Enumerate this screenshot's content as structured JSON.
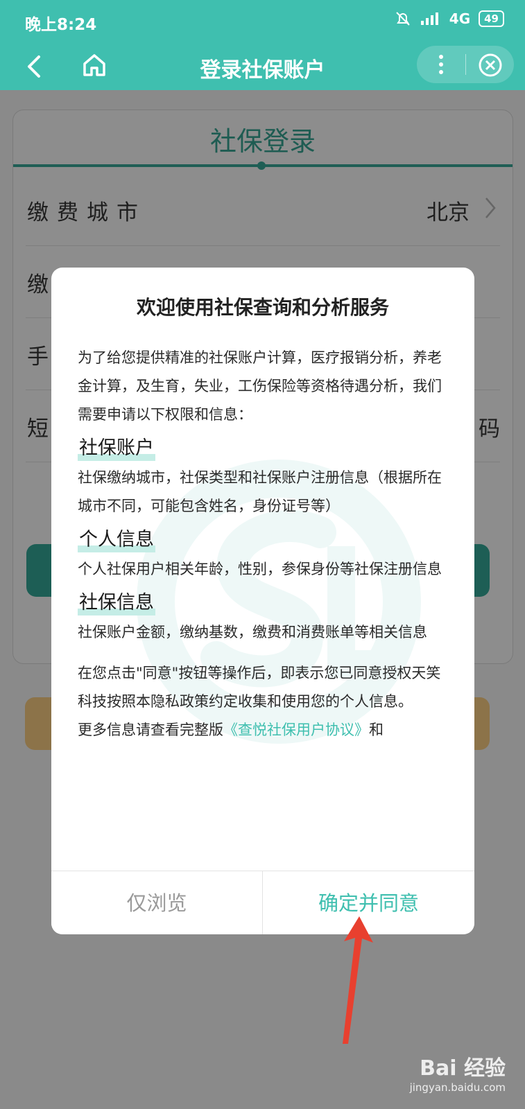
{
  "status_bar": {
    "time": "晚上8:24",
    "network": "4G",
    "battery": "49"
  },
  "header": {
    "title": "登录社保账户"
  },
  "login_card": {
    "title": "社保登录",
    "rows": [
      {
        "label": "缴费城市",
        "value": "北京"
      },
      {
        "label": "缴",
        "value": ""
      },
      {
        "label": "手",
        "value": ""
      },
      {
        "label": "短",
        "value": "码"
      }
    ]
  },
  "modal": {
    "title": "欢迎使用社保查询和分析服务",
    "intro": "为了给您提供精准的社保账户计算，医疗报销分析，养老金计算，及生育，失业，工伤保险等资格待遇分析，我们需要申请以下权限和信息：",
    "sections": [
      {
        "heading": "社保账户",
        "text": "社保缴纳城市，社保类型和社保账户注册信息（根据所在城市不同，可能包含姓名，身份证号等）"
      },
      {
        "heading": "个人信息",
        "text": "个人社保用户相关年龄，性别，参保身份等社保注册信息"
      },
      {
        "heading": "社保信息",
        "text": "社保账户金额，缴纳基数，缴费和消费账单等相关信息"
      }
    ],
    "consent_text": "在您点击\"同意\"按钮等操作后，即表示您已同意授权天笑科技按照本隐私政策约定收集和使用您的个人信息。",
    "more_prefix": "更多信息请查看完整版",
    "agreement_link": "《查悦社保用户协议》",
    "more_suffix": "和",
    "browse_button": "仅浏览",
    "agree_button": "确定并同意"
  },
  "watermark": {
    "brand": "Bai 经验",
    "url": "jingyan.baidu.com"
  },
  "colors": {
    "accent": "#3fbfaf",
    "card_dark": "#1d5e55",
    "gold": "#8c7349",
    "arrow": "#e8402f"
  }
}
